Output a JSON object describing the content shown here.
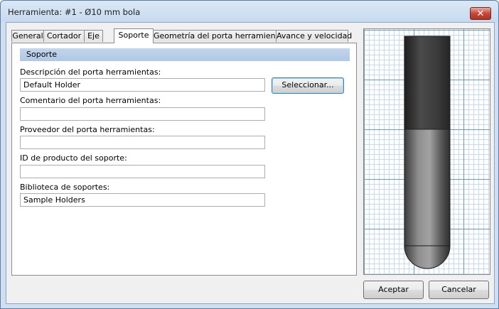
{
  "window": {
    "title": "Herramienta: #1 - Ø10 mm bola",
    "close_glyph": "✕"
  },
  "tabs": [
    {
      "label": "General",
      "active": false
    },
    {
      "label": "Cortador",
      "active": false
    },
    {
      "label": "Eje",
      "active": false
    },
    {
      "label": "Soporte",
      "active": true
    },
    {
      "label": "Geometría del porta herramientas",
      "active": false
    },
    {
      "label": "Avance y velocidad",
      "active": false
    }
  ],
  "panel": {
    "section_title": "Soporte",
    "fields": {
      "holder_description": {
        "label": "Descripción del porta herramientas:",
        "value": "Default Holder"
      },
      "holder_comment": {
        "label": "Comentario del porta herramientas:",
        "value": ""
      },
      "holder_vendor": {
        "label": "Proveedor del porta herramientas:",
        "value": ""
      },
      "holder_product_id": {
        "label": "ID de producto del soporte:",
        "value": ""
      },
      "holder_library": {
        "label": "Biblioteca de soportes:",
        "value": "Sample Holders"
      }
    },
    "select_button_label": "Seleccionar..."
  },
  "preview": {
    "icon": "tool-holder-preview-icon",
    "colors": {
      "holder_dark": "#3a3a3a",
      "tool_grey": "#8f8f8f",
      "grid_major": "#6b9dc4",
      "grid_minor": "#c6dcec"
    }
  },
  "buttons": {
    "ok_label": "Aceptar",
    "cancel_label": "Cancelar"
  }
}
